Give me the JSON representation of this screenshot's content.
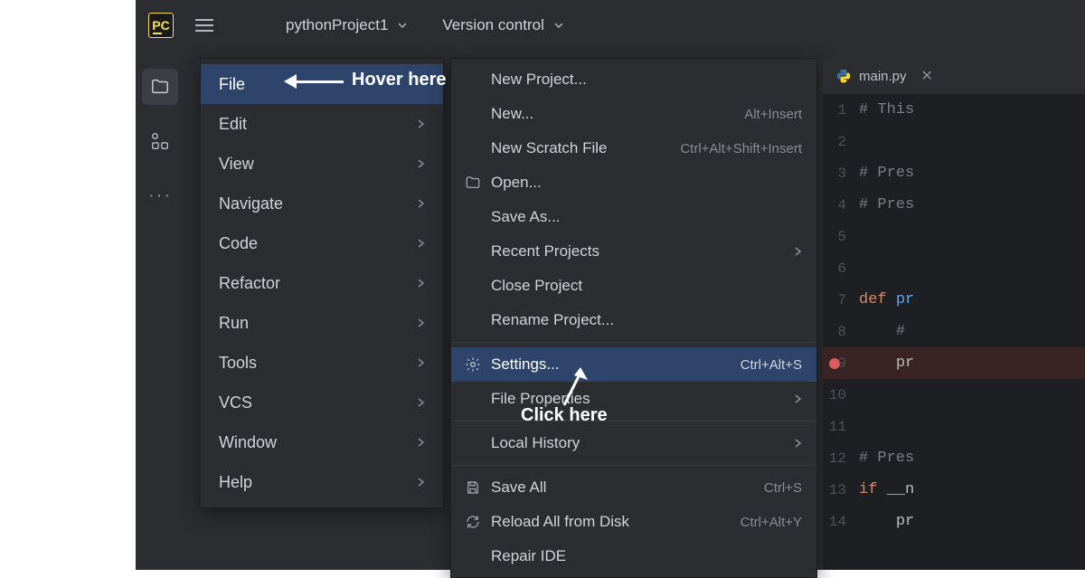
{
  "toolbar": {
    "project_name": "pythonProject1",
    "version_control_label": "Version control"
  },
  "main_menu": {
    "items": [
      {
        "label": "File",
        "has_sub": false,
        "hovered": true
      },
      {
        "label": "Edit",
        "has_sub": true
      },
      {
        "label": "View",
        "has_sub": true
      },
      {
        "label": "Navigate",
        "has_sub": true
      },
      {
        "label": "Code",
        "has_sub": true
      },
      {
        "label": "Refactor",
        "has_sub": true
      },
      {
        "label": "Run",
        "has_sub": true
      },
      {
        "label": "Tools",
        "has_sub": true
      },
      {
        "label": "VCS",
        "has_sub": true
      },
      {
        "label": "Window",
        "has_sub": true
      },
      {
        "label": "Help",
        "has_sub": true
      }
    ]
  },
  "file_menu": {
    "groups": [
      [
        {
          "label": "New Project...",
          "shortcut": "",
          "icon": "",
          "sub": false
        },
        {
          "label": "New...",
          "shortcut": "Alt+Insert",
          "icon": "",
          "sub": false
        },
        {
          "label": "New Scratch File",
          "shortcut": "Ctrl+Alt+Shift+Insert",
          "icon": "",
          "sub": false
        },
        {
          "label": "Open...",
          "shortcut": "",
          "icon": "folder",
          "sub": false
        },
        {
          "label": "Save As...",
          "shortcut": "",
          "icon": "",
          "sub": false
        },
        {
          "label": "Recent Projects",
          "shortcut": "",
          "icon": "",
          "sub": true
        },
        {
          "label": "Close Project",
          "shortcut": "",
          "icon": "",
          "sub": false
        },
        {
          "label": "Rename Project...",
          "shortcut": "",
          "icon": "",
          "sub": false
        }
      ],
      [
        {
          "label": "Settings...",
          "shortcut": "Ctrl+Alt+S",
          "icon": "gear",
          "sub": false,
          "hovered": true
        },
        {
          "label": "File Properties",
          "shortcut": "",
          "icon": "",
          "sub": true
        }
      ],
      [
        {
          "label": "Local History",
          "shortcut": "",
          "icon": "",
          "sub": true
        }
      ],
      [
        {
          "label": "Save All",
          "shortcut": "Ctrl+S",
          "icon": "save",
          "sub": false
        },
        {
          "label": "Reload All from Disk",
          "shortcut": "Ctrl+Alt+Y",
          "icon": "reload",
          "sub": false
        },
        {
          "label": "Repair IDE",
          "shortcut": "",
          "icon": "",
          "sub": false
        }
      ]
    ]
  },
  "editor": {
    "tab_name": "main.py",
    "lines": [
      {
        "n": 1,
        "html": "<span class='cm-comment'># This</span>"
      },
      {
        "n": 2,
        "html": ""
      },
      {
        "n": 3,
        "html": "<span class='cm-comment'># Pres</span>"
      },
      {
        "n": 4,
        "html": "<span class='cm-comment'># Pres</span>"
      },
      {
        "n": 5,
        "html": ""
      },
      {
        "n": 6,
        "html": ""
      },
      {
        "n": 7,
        "html": "<span class='cm-keyword'>def</span> <span class='cm-def'>pr</span>"
      },
      {
        "n": 8,
        "html": "    <span class='cm-comment'>#</span>"
      },
      {
        "n": 9,
        "html": "    <span class='cm-id'>pr</span>",
        "bp": true
      },
      {
        "n": 10,
        "html": ""
      },
      {
        "n": 11,
        "html": ""
      },
      {
        "n": 12,
        "html": "<span class='cm-comment'># Pres</span>"
      },
      {
        "n": 13,
        "html": "<span class='cm-keyword'>if</span> <span class='cm-id'>__n</span>"
      },
      {
        "n": 14,
        "html": "    <span class='cm-id'>pr</span>"
      }
    ]
  },
  "annotations": {
    "hover_label": "Hover here",
    "click_label": "Click here"
  }
}
